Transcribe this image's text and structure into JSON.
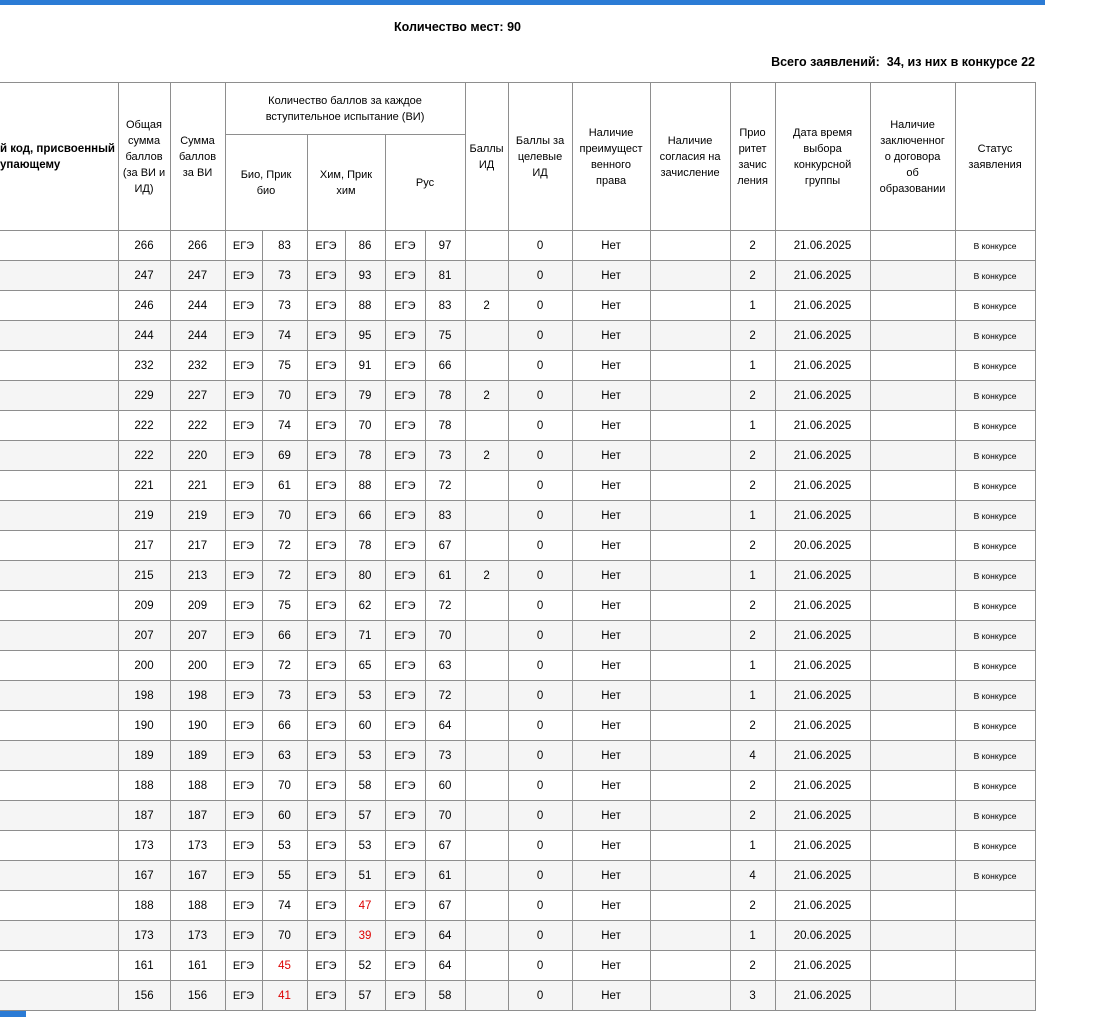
{
  "colors": {
    "accent_blue": "#2b7bd5",
    "fail_score_red": "#dd0000",
    "grid_border": "#8e8e8e",
    "row_stripe": "#f5f5f5"
  },
  "header": {
    "places": "Количество мест: 90",
    "totals": "Всего заявлений:  34, из них в конкурсе 22"
  },
  "table": {
    "headers": {
      "code": [
        "й код, присвоенный",
        "упающему"
      ],
      "total_sum": [
        "Общая",
        "сумма",
        "баллов",
        "(за ВИ и",
        "ИД)"
      ],
      "vi_sum": [
        "Сумма",
        "баллов",
        "за ВИ"
      ],
      "exams_group": [
        "Количество баллов за каждое",
        "вступительное испытание (ВИ)"
      ],
      "bio": [
        "Био, Прик",
        "био"
      ],
      "chem": [
        "Хим, Прик",
        "хим"
      ],
      "rus": [
        "Рус"
      ],
      "id_points": [
        "Баллы",
        "ИД"
      ],
      "target_id_points": [
        "Баллы за",
        "целевые",
        "ИД"
      ],
      "preferential_right": [
        "Наличие",
        "преимущест",
        "венного",
        "права"
      ],
      "enrollment_consent": [
        "Наличие",
        "согласия на",
        "зачисление"
      ],
      "priority": [
        "Прио",
        "ритет",
        "зачис",
        "ления"
      ],
      "group_choice_datetime": [
        "Дата время",
        "выбора",
        "конкурсной",
        "группы"
      ],
      "education_contract": [
        "Наличие",
        "заключенног",
        "о договора",
        "об",
        "образовании"
      ],
      "status": [
        "Статус",
        "заявления"
      ]
    },
    "rows": [
      {
        "c": [
          "266",
          "266",
          "ЕГЭ",
          "83",
          "ЕГЭ",
          "86",
          "ЕГЭ",
          "97",
          "",
          "0",
          "Нет",
          "",
          "2",
          "21.06.2025",
          "",
          "В конкурсе"
        ]
      },
      {
        "c": [
          "247",
          "247",
          "ЕГЭ",
          "73",
          "ЕГЭ",
          "93",
          "ЕГЭ",
          "81",
          "",
          "0",
          "Нет",
          "",
          "2",
          "21.06.2025",
          "",
          "В конкурсе"
        ]
      },
      {
        "c": [
          "246",
          "244",
          "ЕГЭ",
          "73",
          "ЕГЭ",
          "88",
          "ЕГЭ",
          "83",
          "2",
          "0",
          "Нет",
          "",
          "1",
          "21.06.2025",
          "",
          "В конкурсе"
        ]
      },
      {
        "c": [
          "244",
          "244",
          "ЕГЭ",
          "74",
          "ЕГЭ",
          "95",
          "ЕГЭ",
          "75",
          "",
          "0",
          "Нет",
          "",
          "2",
          "21.06.2025",
          "",
          "В конкурсе"
        ]
      },
      {
        "c": [
          "232",
          "232",
          "ЕГЭ",
          "75",
          "ЕГЭ",
          "91",
          "ЕГЭ",
          "66",
          "",
          "0",
          "Нет",
          "",
          "1",
          "21.06.2025",
          "",
          "В конкурсе"
        ]
      },
      {
        "c": [
          "229",
          "227",
          "ЕГЭ",
          "70",
          "ЕГЭ",
          "79",
          "ЕГЭ",
          "78",
          "2",
          "0",
          "Нет",
          "",
          "2",
          "21.06.2025",
          "",
          "В конкурсе"
        ]
      },
      {
        "c": [
          "222",
          "222",
          "ЕГЭ",
          "74",
          "ЕГЭ",
          "70",
          "ЕГЭ",
          "78",
          "",
          "0",
          "Нет",
          "",
          "1",
          "21.06.2025",
          "",
          "В конкурсе"
        ]
      },
      {
        "c": [
          "222",
          "220",
          "ЕГЭ",
          "69",
          "ЕГЭ",
          "78",
          "ЕГЭ",
          "73",
          "2",
          "0",
          "Нет",
          "",
          "2",
          "21.06.2025",
          "",
          "В конкурсе"
        ]
      },
      {
        "c": [
          "221",
          "221",
          "ЕГЭ",
          "61",
          "ЕГЭ",
          "88",
          "ЕГЭ",
          "72",
          "",
          "0",
          "Нет",
          "",
          "2",
          "21.06.2025",
          "",
          "В конкурсе"
        ]
      },
      {
        "c": [
          "219",
          "219",
          "ЕГЭ",
          "70",
          "ЕГЭ",
          "66",
          "ЕГЭ",
          "83",
          "",
          "0",
          "Нет",
          "",
          "1",
          "21.06.2025",
          "",
          "В конкурсе"
        ]
      },
      {
        "c": [
          "217",
          "217",
          "ЕГЭ",
          "72",
          "ЕГЭ",
          "78",
          "ЕГЭ",
          "67",
          "",
          "0",
          "Нет",
          "",
          "2",
          "20.06.2025",
          "",
          "В конкурсе"
        ]
      },
      {
        "c": [
          "215",
          "213",
          "ЕГЭ",
          "72",
          "ЕГЭ",
          "80",
          "ЕГЭ",
          "61",
          "2",
          "0",
          "Нет",
          "",
          "1",
          "21.06.2025",
          "",
          "В конкурсе"
        ]
      },
      {
        "c": [
          "209",
          "209",
          "ЕГЭ",
          "75",
          "ЕГЭ",
          "62",
          "ЕГЭ",
          "72",
          "",
          "0",
          "Нет",
          "",
          "2",
          "21.06.2025",
          "",
          "В конкурсе"
        ]
      },
      {
        "c": [
          "207",
          "207",
          "ЕГЭ",
          "66",
          "ЕГЭ",
          "71",
          "ЕГЭ",
          "70",
          "",
          "0",
          "Нет",
          "",
          "2",
          "21.06.2025",
          "",
          "В конкурсе"
        ]
      },
      {
        "c": [
          "200",
          "200",
          "ЕГЭ",
          "72",
          "ЕГЭ",
          "65",
          "ЕГЭ",
          "63",
          "",
          "0",
          "Нет",
          "",
          "1",
          "21.06.2025",
          "",
          "В конкурсе"
        ]
      },
      {
        "c": [
          "198",
          "198",
          "ЕГЭ",
          "73",
          "ЕГЭ",
          "53",
          "ЕГЭ",
          "72",
          "",
          "0",
          "Нет",
          "",
          "1",
          "21.06.2025",
          "",
          "В конкурсе"
        ]
      },
      {
        "c": [
          "190",
          "190",
          "ЕГЭ",
          "66",
          "ЕГЭ",
          "60",
          "ЕГЭ",
          "64",
          "",
          "0",
          "Нет",
          "",
          "2",
          "21.06.2025",
          "",
          "В конкурсе"
        ]
      },
      {
        "c": [
          "189",
          "189",
          "ЕГЭ",
          "63",
          "ЕГЭ",
          "53",
          "ЕГЭ",
          "73",
          "",
          "0",
          "Нет",
          "",
          "4",
          "21.06.2025",
          "",
          "В конкурсе"
        ]
      },
      {
        "c": [
          "188",
          "188",
          "ЕГЭ",
          "70",
          "ЕГЭ",
          "58",
          "ЕГЭ",
          "60",
          "",
          "0",
          "Нет",
          "",
          "2",
          "21.06.2025",
          "",
          "В конкурсе"
        ]
      },
      {
        "c": [
          "187",
          "187",
          "ЕГЭ",
          "60",
          "ЕГЭ",
          "57",
          "ЕГЭ",
          "70",
          "",
          "0",
          "Нет",
          "",
          "2",
          "21.06.2025",
          "",
          "В конкурсе"
        ]
      },
      {
        "c": [
          "173",
          "173",
          "ЕГЭ",
          "53",
          "ЕГЭ",
          "53",
          "ЕГЭ",
          "67",
          "",
          "0",
          "Нет",
          "",
          "1",
          "21.06.2025",
          "",
          "В конкурсе"
        ]
      },
      {
        "c": [
          "167",
          "167",
          "ЕГЭ",
          "55",
          "ЕГЭ",
          "51",
          "ЕГЭ",
          "61",
          "",
          "0",
          "Нет",
          "",
          "4",
          "21.06.2025",
          "",
          "В конкурсе"
        ]
      },
      {
        "c": [
          "188",
          "188",
          "ЕГЭ",
          "74",
          "ЕГЭ",
          "47",
          "ЕГЭ",
          "67",
          "",
          "0",
          "Нет",
          "",
          "2",
          "21.06.2025",
          "",
          ""
        ],
        "red": [
          5
        ]
      },
      {
        "c": [
          "173",
          "173",
          "ЕГЭ",
          "70",
          "ЕГЭ",
          "39",
          "ЕГЭ",
          "64",
          "",
          "0",
          "Нет",
          "",
          "1",
          "20.06.2025",
          "",
          ""
        ],
        "red": [
          5
        ]
      },
      {
        "c": [
          "161",
          "161",
          "ЕГЭ",
          "45",
          "ЕГЭ",
          "52",
          "ЕГЭ",
          "64",
          "",
          "0",
          "Нет",
          "",
          "2",
          "21.06.2025",
          "",
          ""
        ],
        "red": [
          3
        ]
      },
      {
        "c": [
          "156",
          "156",
          "ЕГЭ",
          "41",
          "ЕГЭ",
          "57",
          "ЕГЭ",
          "58",
          "",
          "0",
          "Нет",
          "",
          "3",
          "21.06.2025",
          "",
          ""
        ],
        "red": [
          3
        ]
      }
    ]
  }
}
